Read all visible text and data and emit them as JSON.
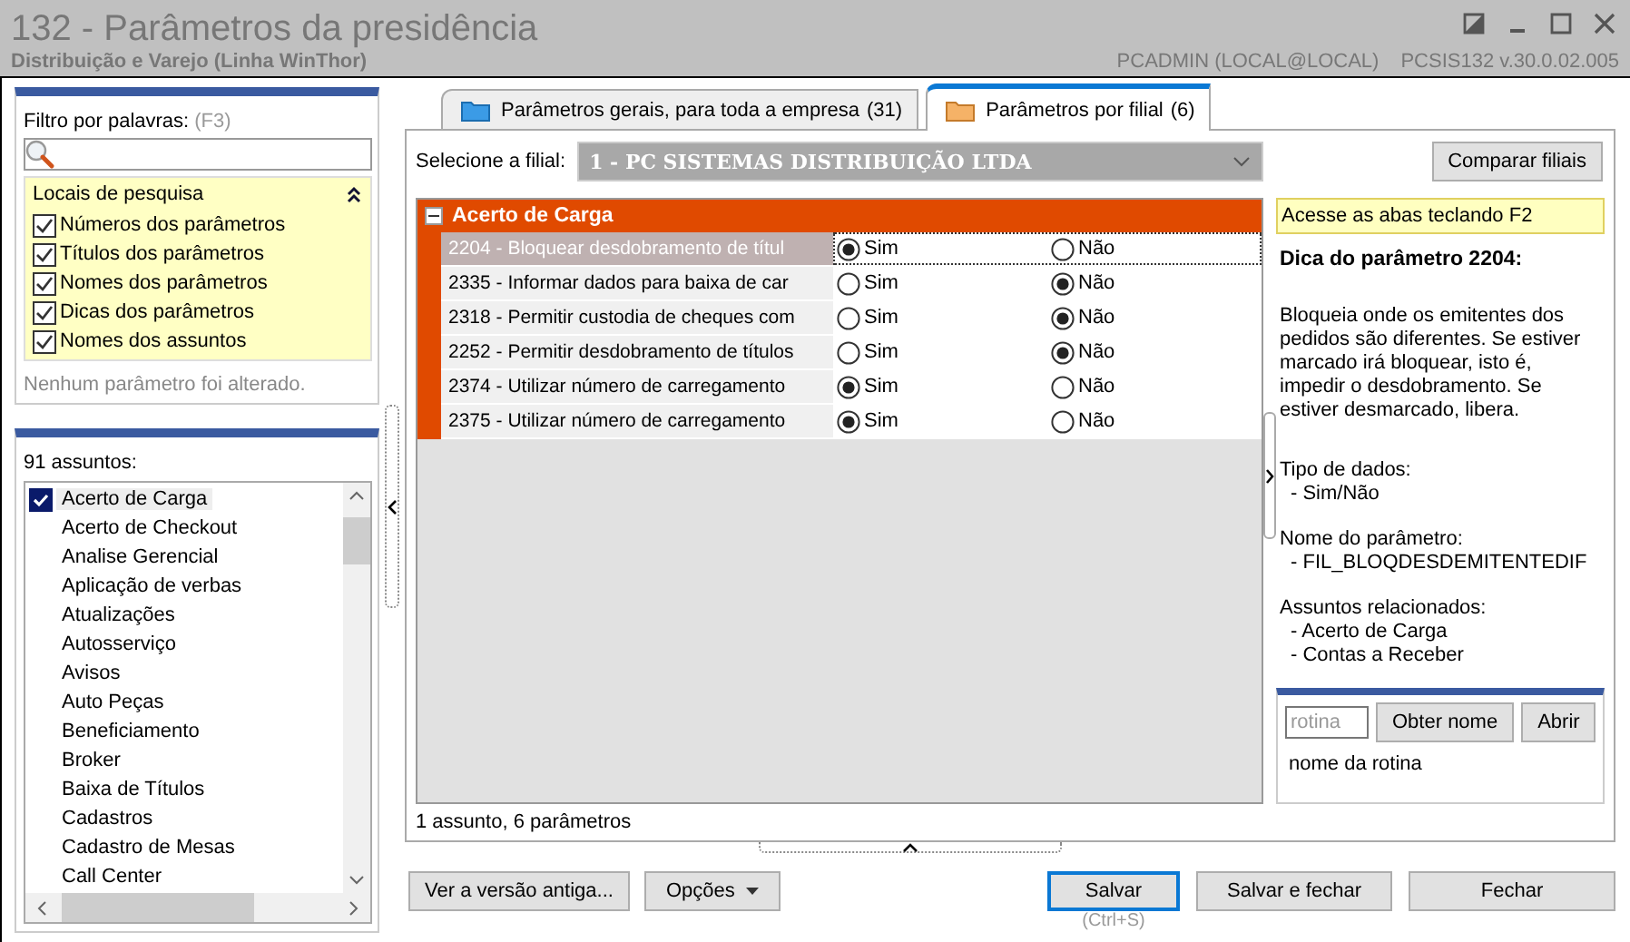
{
  "window": {
    "title": "132 - Parâmetros da presidência",
    "subtitle": "Distribuição e Varejo (Linha WinThor)",
    "user": "PCADMIN (LOCAL@LOCAL)",
    "version": "PCSIS132  v.30.0.02.005"
  },
  "filter": {
    "label": "Filtro por palavras:",
    "shortcut": "(F3)"
  },
  "search_locations": {
    "title": "Locais de pesquisa",
    "expanded": true,
    "options": [
      {
        "label": "Números dos parâmetros",
        "checked": true
      },
      {
        "label": "Títulos dos parâmetros",
        "checked": true
      },
      {
        "label": "Nomes dos parâmetros",
        "checked": true
      },
      {
        "label": "Dicas dos parâmetros",
        "checked": true
      },
      {
        "label": "Nomes dos assuntos",
        "checked": true
      }
    ]
  },
  "status_message": "Nenhum parâmetro foi alterado.",
  "subjects": {
    "count_label": "91 assuntos:",
    "items": [
      {
        "label": "Acerto de Carga",
        "checked": true
      },
      {
        "label": "Acerto de Checkout",
        "checked": false
      },
      {
        "label": "Analise Gerencial",
        "checked": false
      },
      {
        "label": "Aplicação de verbas",
        "checked": false
      },
      {
        "label": "Atualizações",
        "checked": false
      },
      {
        "label": "Autosserviço",
        "checked": false
      },
      {
        "label": "Avisos",
        "checked": false
      },
      {
        "label": "Auto Peças",
        "checked": false
      },
      {
        "label": "Beneficiamento",
        "checked": false
      },
      {
        "label": "Broker",
        "checked": false
      },
      {
        "label": "Baixa de Títulos",
        "checked": false
      },
      {
        "label": "Cadastros",
        "checked": false
      },
      {
        "label": "Cadastro de Mesas",
        "checked": false
      },
      {
        "label": "Call Center",
        "checked": false
      }
    ]
  },
  "tabs": [
    {
      "label": "Parâmetros gerais, para toda a empresa",
      "count": "(31)",
      "selected": false
    },
    {
      "label": "Parâmetros por filial",
      "count": "(6)",
      "selected": true
    }
  ],
  "branch": {
    "label": "Selecione a filial:",
    "value": "1 - PC SISTEMAS DISTRIBUIÇÃO LTDA"
  },
  "compare_button": "Comparar filiais",
  "group": {
    "title": "Acerto de Carga",
    "expanded": true,
    "params": [
      {
        "title": "2204 - Bloquear desdobramento de títul",
        "selected": true,
        "options": [
          {
            "label": "Sim",
            "checked": true
          },
          {
            "label": "Não",
            "checked": false
          }
        ]
      },
      {
        "title": "2335 - Informar dados para baixa de car",
        "selected": false,
        "options": [
          {
            "label": "Sim",
            "checked": false
          },
          {
            "label": "Não",
            "checked": true
          }
        ]
      },
      {
        "title": "2318 - Permitir custodia de cheques com",
        "selected": false,
        "options": [
          {
            "label": "Sim",
            "checked": false
          },
          {
            "label": "Não",
            "checked": true
          }
        ]
      },
      {
        "title": "2252 - Permitir desdobramento de títulos",
        "selected": false,
        "options": [
          {
            "label": "Sim",
            "checked": false
          },
          {
            "label": "Não",
            "checked": true
          }
        ]
      },
      {
        "title": "2374 - Utilizar número de carregamento",
        "selected": false,
        "options": [
          {
            "label": "Sim",
            "checked": true
          },
          {
            "label": "Não",
            "checked": false
          }
        ]
      },
      {
        "title": "2375 - Utilizar número de carregamento",
        "selected": false,
        "options": [
          {
            "label": "Sim",
            "checked": true
          },
          {
            "label": "Não",
            "checked": false
          }
        ]
      }
    ]
  },
  "summary": "1 assunto, 6 parâmetros",
  "hint_banner": "Acesse as abas teclando F2",
  "tip": {
    "title": "Dica do parâmetro 2204:",
    "description": "Bloqueia onde os emitentes dos pedidos são diferentes. Se estiver marcado irá bloquear, isto é, impedir o desdobramento. Se estiver desmarcado, libera.",
    "sections": [
      {
        "heading": "Tipo de dados:",
        "items": [
          "- Sim/Não"
        ]
      },
      {
        "heading": "Nome do parâmetro:",
        "items": [
          "- FIL_BLOQDESDEMITENTEDIF"
        ]
      },
      {
        "heading": "Assuntos relacionados:",
        "items": [
          "- Acerto de Carga",
          "- Contas a Receber"
        ]
      }
    ]
  },
  "routine": {
    "placeholder": "rotina",
    "buttons": [
      "Obter nome",
      "Abrir"
    ],
    "name": "nome da rotina"
  },
  "footer_buttons": [
    {
      "label": "Ver a versão antiga...",
      "kind": "plain"
    },
    {
      "label": "Opções",
      "kind": "menu"
    },
    {
      "label": "Salvar",
      "kind": "default",
      "shortcut": "(Ctrl+S)"
    },
    {
      "label": "Salvar e fechar",
      "kind": "plain"
    },
    {
      "label": "Fechar",
      "kind": "plain"
    }
  ]
}
